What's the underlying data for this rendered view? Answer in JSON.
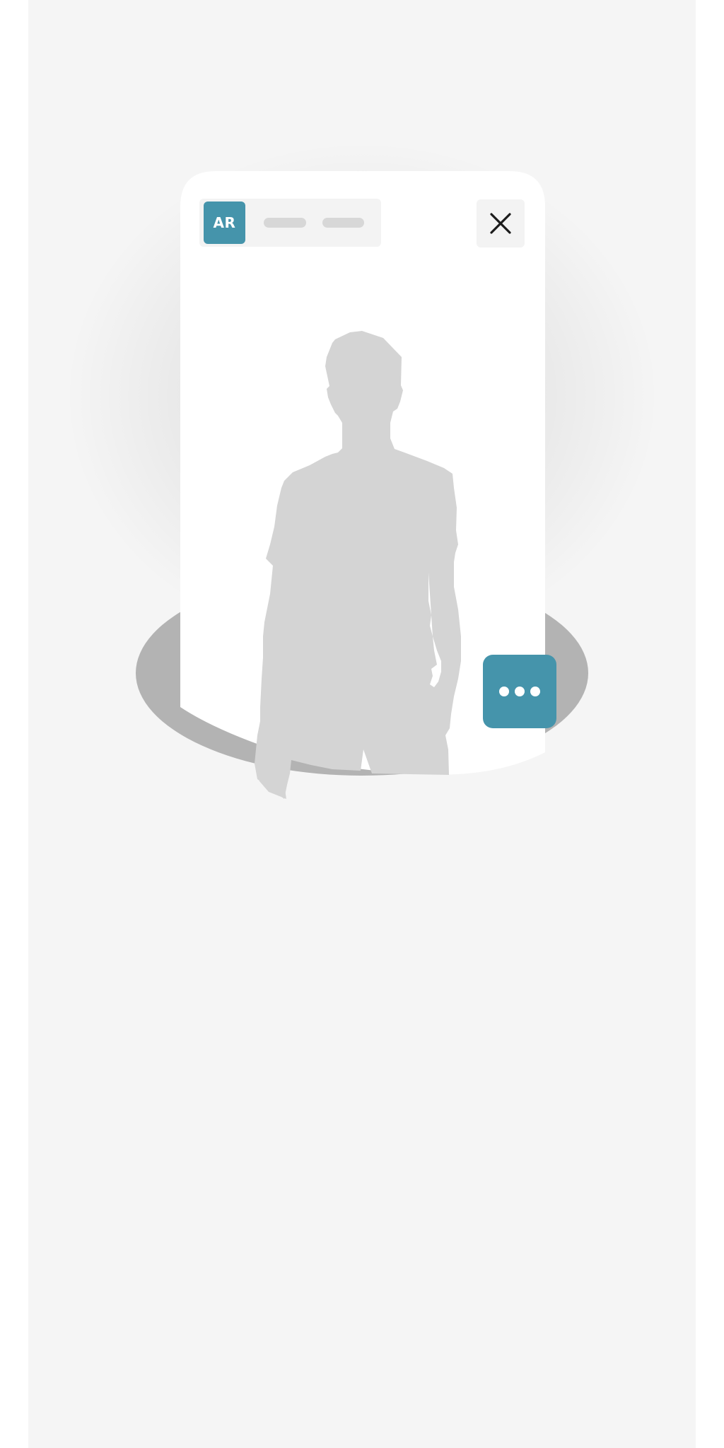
{
  "app": {
    "badge_label": "AR",
    "badge_color": "#4594ab",
    "background_color": "#f5f5f5"
  },
  "toolbar": {
    "placeholder_pills": [
      "",
      ""
    ],
    "close_icon": "close-icon"
  },
  "viewer": {
    "subject": "person-silhouette",
    "base_shape": "oval-platform"
  },
  "actions": {
    "more_icon": "more-horizontal-icon",
    "more_color": "#4594ab"
  }
}
